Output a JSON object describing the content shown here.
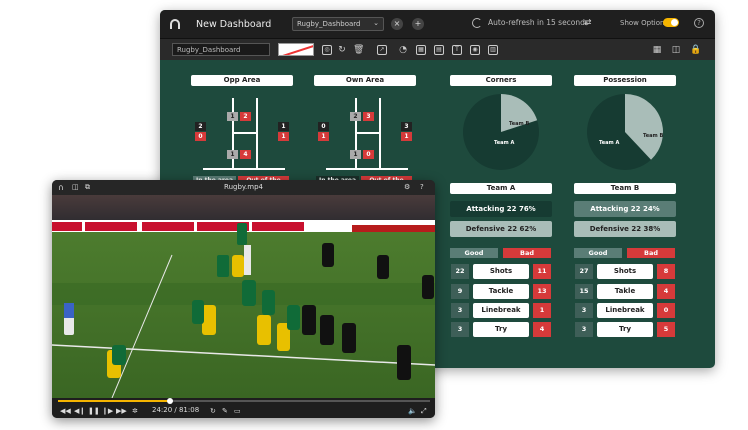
{
  "dashboard": {
    "title": "New Dashboard",
    "selected_dashboard": "Rugby_Dashboard",
    "auto_refresh": "Auto-refresh in 15 seconds",
    "show_options": "Show Options",
    "toolbar_input_value": "Rugby_Dashboard",
    "icons": [
      "grid-icon",
      "layout-icon",
      "lock-icon"
    ]
  },
  "opp_area": {
    "title": "Opp Area",
    "left_counts": [
      "2",
      "0"
    ],
    "right_counts": [
      "1",
      "1"
    ],
    "top_pair": [
      "1",
      "2"
    ],
    "bottom_pair": [
      "1",
      "4"
    ],
    "in_label": "In the area",
    "out_label": "Out of the area"
  },
  "own_area": {
    "title": "Own Area",
    "left_counts": [
      "0",
      "1"
    ],
    "right_counts": [
      "3",
      "1"
    ],
    "top_pair": [
      "2",
      "3"
    ],
    "bottom_pair": [
      "1",
      "0"
    ],
    "in_label": "In the area",
    "out_label": "Out of the area"
  },
  "corners": {
    "title": "Corners",
    "team_a_label": "Team A",
    "team_b_label": "Team B",
    "team_b_fraction": 0.2
  },
  "possession": {
    "title": "Possession",
    "team_a_label": "Team A",
    "team_b_label": "Team B",
    "team_b_fraction": 0.38
  },
  "team_a": {
    "title": "Team A",
    "attacking": "Attacking 22 76%",
    "defensive": "Defensive 22 62%",
    "good": "Good",
    "bad": "Bad",
    "rows": [
      {
        "good": "22",
        "label": "Shots",
        "bad": "11"
      },
      {
        "good": "9",
        "label": "Tackle",
        "bad": "13"
      },
      {
        "good": "3",
        "label": "Linebreak",
        "bad": "1"
      },
      {
        "good": "3",
        "label": "Try",
        "bad": "4"
      }
    ]
  },
  "team_b": {
    "title": "Team B",
    "attacking": "Attacking 22 24%",
    "defensive": "Defensive 22 38%",
    "good": "Good",
    "bad": "Bad",
    "rows": [
      {
        "good": "27",
        "label": "Shots",
        "bad": "8"
      },
      {
        "good": "15",
        "label": "Takle",
        "bad": "4"
      },
      {
        "good": "3",
        "label": "Linebreak",
        "bad": "0"
      },
      {
        "good": "3",
        "label": "Try",
        "bad": "5"
      }
    ]
  },
  "video": {
    "filename": "Rugby.mp4",
    "time": "24:20 / 81:08",
    "progress": 0.3,
    "colors": {
      "accent": "#f5b400",
      "bad": "#d63a3a",
      "panel": "#1e4a3d"
    }
  }
}
